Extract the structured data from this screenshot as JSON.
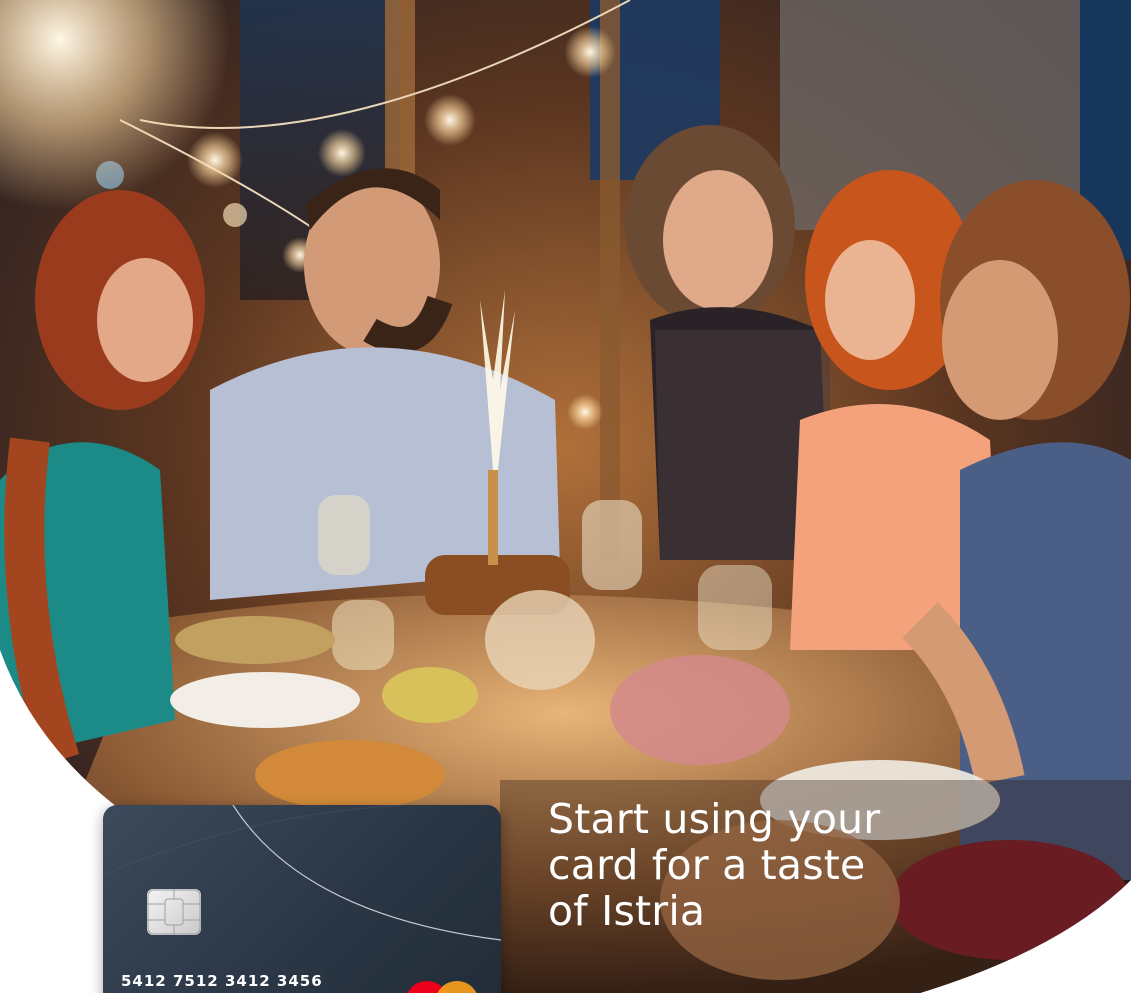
{
  "promo": {
    "headline_lines": [
      "Start using your",
      "card for a taste",
      "of Istria"
    ]
  },
  "card": {
    "number": "5412 7512 3412 3456",
    "network_logo": "mastercard-logo",
    "chip_icon": "chip-icon"
  },
  "photo": {
    "subject": "friends-dinner-celebration-photo"
  },
  "colors": {
    "card_background": "#2b3746",
    "text_on_photo": "#ffffff",
    "mastercard_red": "#eb001b",
    "mastercard_yellow": "#f79e1b"
  }
}
